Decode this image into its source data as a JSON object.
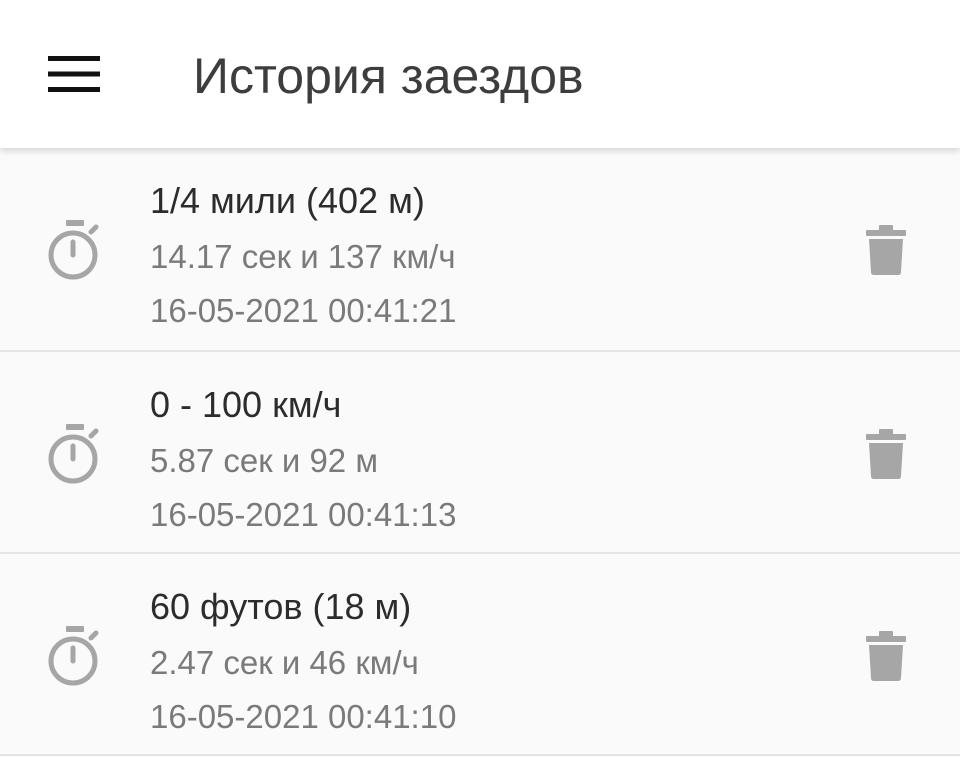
{
  "appbar": {
    "menu_icon": "menu-icon",
    "title": "История заездов"
  },
  "colors": {
    "icon_gray": "#a6a6a6",
    "title": "#3d3d3d",
    "secondary_text": "#7a7a7a",
    "divider": "#e4e4e4"
  },
  "runs": [
    {
      "icon": "stopwatch-icon",
      "title": "1/4 мили (402 м)",
      "result": "14.17 сек и 137 км/ч",
      "datetime": "16-05-2021 00:41:21",
      "action_icon": "delete-icon"
    },
    {
      "icon": "stopwatch-icon",
      "title": "0 - 100 км/ч",
      "result": "5.87 сек и 92 м",
      "datetime": "16-05-2021 00:41:13",
      "action_icon": "delete-icon"
    },
    {
      "icon": "stopwatch-icon",
      "title": "60 футов (18 м)",
      "result": "2.47 сек и 46 км/ч",
      "datetime": "16-05-2021 00:41:10",
      "action_icon": "delete-icon"
    }
  ]
}
